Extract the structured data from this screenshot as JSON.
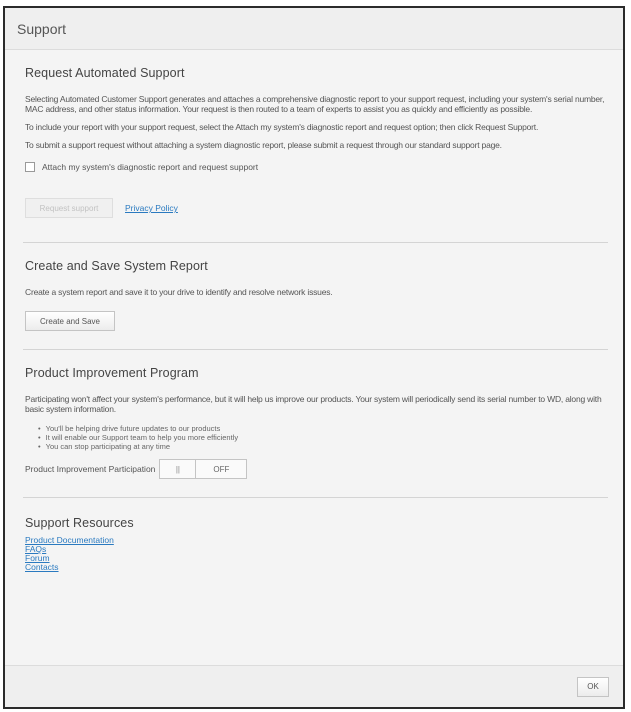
{
  "dialog": {
    "title": "Support"
  },
  "automated": {
    "title": "Request Automated Support",
    "para1": "Selecting Automated Customer Support generates and attaches a comprehensive diagnostic report to your support request, including your system's serial number, MAC address, and other status information. Your request is then routed to a team of experts to assist you as quickly and efficiently as possible.",
    "para2": "To include your report with your support request, select the Attach my system's diagnostic report and request option; then click Request Support.",
    "para3": "To submit a support request without attaching a system diagnostic report, please submit a request through our standard support page.",
    "checkbox_label": "Attach my system's diagnostic report and request support",
    "checkbox_checked": false,
    "request_button": "Request support",
    "privacy_link": "Privacy Policy"
  },
  "report": {
    "title": "Create and Save System Report",
    "description": "Create a system report and save it to your drive to identify and resolve network issues.",
    "button": "Create and Save"
  },
  "improvement": {
    "title": "Product Improvement Program",
    "description": "Participating won't affect your system's performance, but it will help us improve our products. Your system will periodically send its serial number to WD, along with basic system information.",
    "bullets": [
      "You'll be helping drive future updates to our products",
      "It will enable our Support team to help you more efficiently",
      "You can stop participating at any time"
    ],
    "toggle_label": "Product Improvement Participation",
    "toggle_knob": "||",
    "toggle_state": "OFF"
  },
  "resources": {
    "title": "Support Resources",
    "links": [
      "Product Documentation",
      "FAQs",
      "Forum",
      "Contacts"
    ]
  },
  "footer": {
    "ok_label": "OK"
  }
}
